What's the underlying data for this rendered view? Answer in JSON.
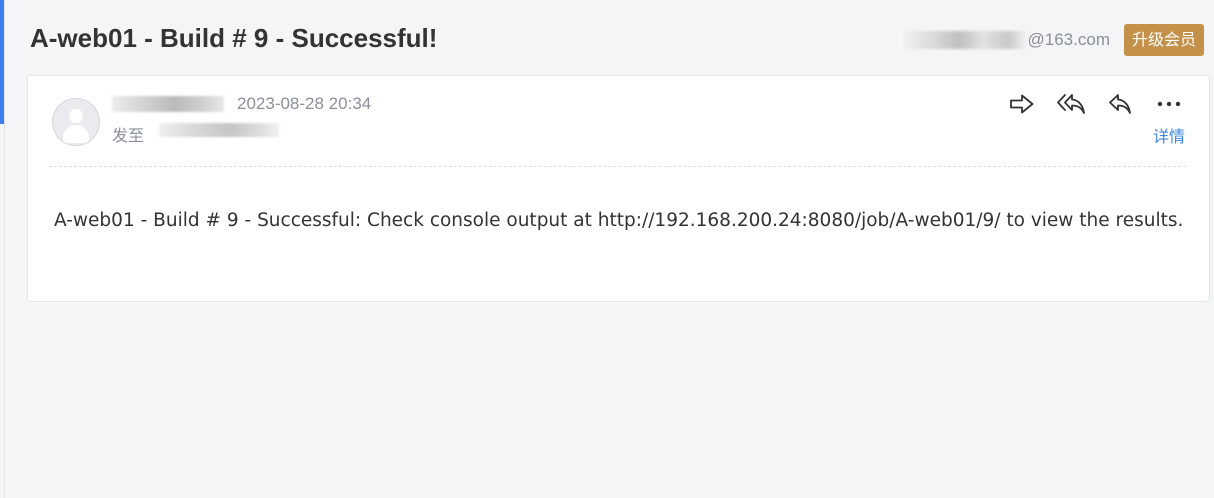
{
  "header": {
    "subject": "A-web01 - Build # 9 - Successful!",
    "account_email_suffix": "@163.com",
    "vip_label": "升级会员"
  },
  "mail": {
    "send_time": "2023-08-28 20:34",
    "to_label": "发至",
    "details_label": "详情",
    "actions": {
      "forward_icon": "forward-arrow-icon",
      "reply_all_icon": "reply-all-icon",
      "reply_icon": "reply-icon",
      "more_icon": "more-dots-icon"
    },
    "body_text": "A-web01 - Build # 9 - Successful: Check console output at http://192.168.200.24:8080/job/A-web01/9/ to view the results."
  },
  "colors": {
    "accent_blue": "#3f7ef0",
    "vip_gold": "#c4914a",
    "link_blue": "#3b86e0",
    "muted_text": "#8a8f99",
    "background": "#f4f5f7"
  }
}
